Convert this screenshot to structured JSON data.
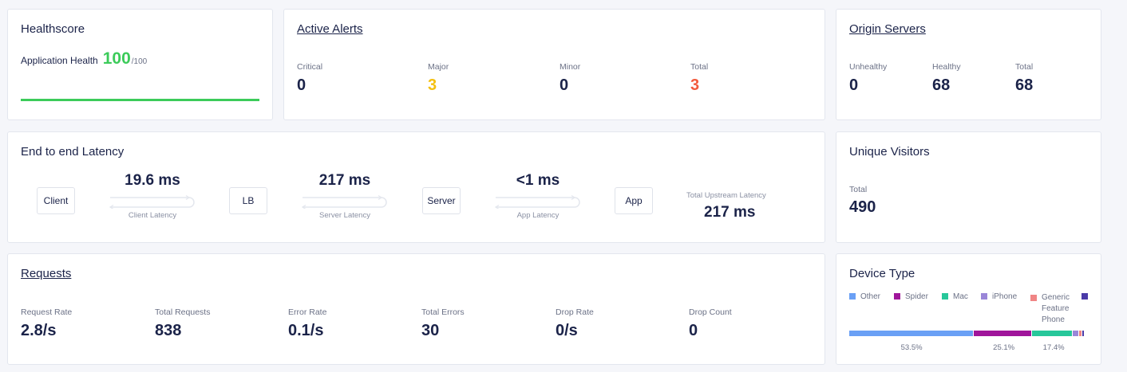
{
  "healthscore": {
    "title": "Healthscore",
    "label": "Application Health",
    "score": "100",
    "max": "/100",
    "color": "#3ccb5a",
    "fraction": 1.0
  },
  "alerts": {
    "title": "Active Alerts",
    "items": [
      {
        "label": "Critical",
        "value": "0",
        "color": "#1b2349"
      },
      {
        "label": "Major",
        "value": "3",
        "color": "#f4c010"
      },
      {
        "label": "Minor",
        "value": "0",
        "color": "#1b2349"
      },
      {
        "label": "Total",
        "value": "3",
        "color": "#f25a3c"
      }
    ]
  },
  "origin": {
    "title": "Origin Servers",
    "items": [
      {
        "label": "Unhealthy",
        "value": "0"
      },
      {
        "label": "Healthy",
        "value": "68"
      },
      {
        "label": "Total",
        "value": "68"
      }
    ]
  },
  "latency": {
    "title": "End to end Latency",
    "nodes": [
      "Client",
      "LB",
      "Server",
      "App"
    ],
    "segments": [
      {
        "value": "19.6 ms",
        "label": "Client Latency"
      },
      {
        "value": "217 ms",
        "label": "Server Latency"
      },
      {
        "value": "<1 ms",
        "label": "App Latency"
      }
    ],
    "total_label": "Total Upstream Latency",
    "total_value": "217 ms"
  },
  "visitors": {
    "title": "Unique Visitors",
    "label": "Total",
    "value": "490"
  },
  "requests": {
    "title": "Requests",
    "items": [
      {
        "label": "Request Rate",
        "value": "2.8/s"
      },
      {
        "label": "Total Requests",
        "value": "838"
      },
      {
        "label": "Error Rate",
        "value": "0.1/s"
      },
      {
        "label": "Total Errors",
        "value": "30"
      },
      {
        "label": "Drop Rate",
        "value": "0/s"
      },
      {
        "label": "Drop Count",
        "value": "0"
      }
    ]
  },
  "device": {
    "title": "Device Type",
    "legend": [
      {
        "label": "Other",
        "color": "#6aa0f5"
      },
      {
        "label": "Spider",
        "color": "#a0169b"
      },
      {
        "label": "Mac",
        "color": "#27c79a"
      },
      {
        "label": "iPhone",
        "color": "#9a86d8"
      },
      {
        "label": "Generic Feature Phone",
        "color": "#f08585"
      },
      {
        "label": "",
        "color": "#4a3aa8"
      }
    ],
    "shares": [
      53.5,
      25.1,
      17.4,
      2.3,
      0.9,
      0.8
    ],
    "pct_labels": [
      "53.5%",
      "25.1%",
      "17.4%"
    ]
  }
}
